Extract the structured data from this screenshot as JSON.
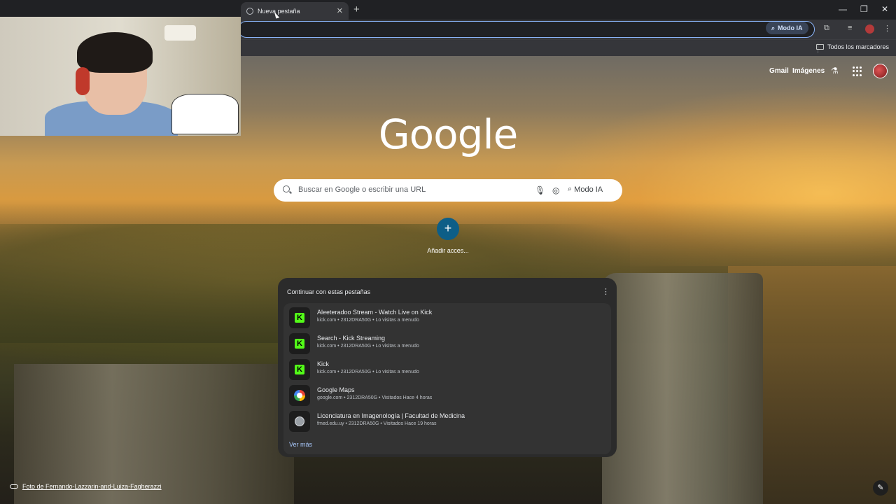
{
  "browser": {
    "tab": {
      "title": "Nueva pestaña",
      "close_glyph": "✕",
      "favicon": "chrome-icon"
    },
    "new_tab_glyph": "+",
    "window_controls": {
      "minimize": "—",
      "maximize": "❐",
      "close": "✕"
    },
    "toolbar": {
      "ai_mode_chip": "Modo IA",
      "extensions_icon": "puzzle-icon",
      "media_icon": "media-icon",
      "menu_glyph": "⋮"
    },
    "bookmarks": {
      "all_bookmarks": "Todos los marcadores"
    }
  },
  "ntp": {
    "top_links": {
      "gmail": "Gmail",
      "images": "Imágenes"
    },
    "logo": "Google",
    "search": {
      "placeholder": "Buscar en Google o escribir una URL",
      "ai_mode": "Modo IA"
    },
    "add_shortcut": {
      "glyph": "+",
      "label": "Añadir acces..."
    },
    "continue_panel": {
      "title": "Continuar con estas pestañas",
      "menu_glyph": "⋮",
      "items": [
        {
          "icon": "kick-icon",
          "title": "Aleeteradoo Stream - Watch Live on Kick",
          "sub": "kick.com • 2312DRA50G • Lo visitas a menudo"
        },
        {
          "icon": "kick-icon",
          "title": "Search - Kick Streaming",
          "sub": "kick.com • 2312DRA50G • Lo visitas a menudo"
        },
        {
          "icon": "kick-icon",
          "title": "Kick",
          "sub": "kick.com • 2312DRA50G • Lo visitas a menudo"
        },
        {
          "icon": "google-icon",
          "title": "Google Maps",
          "sub": "google.com • 2312DRA50G • Visitados Hace 4 horas"
        },
        {
          "icon": "globe-icon",
          "title": "Licenciatura en Imagenología | Facultad de Medicina",
          "sub": "fmed.edu.uy • 2312DRA50G • Visitados Hace 19 horas"
        }
      ],
      "see_more": "Ver más"
    },
    "photo_credit": "Foto de Fernando-Lazzarin-and-Luiza-Fagherazzi",
    "edit_glyph": "✎"
  },
  "colors": {
    "accent_blue": "#8ab4f8",
    "add_button": "#0d5e87",
    "kick_green": "#53fc18",
    "panel_bg": "#2b2b2b"
  }
}
